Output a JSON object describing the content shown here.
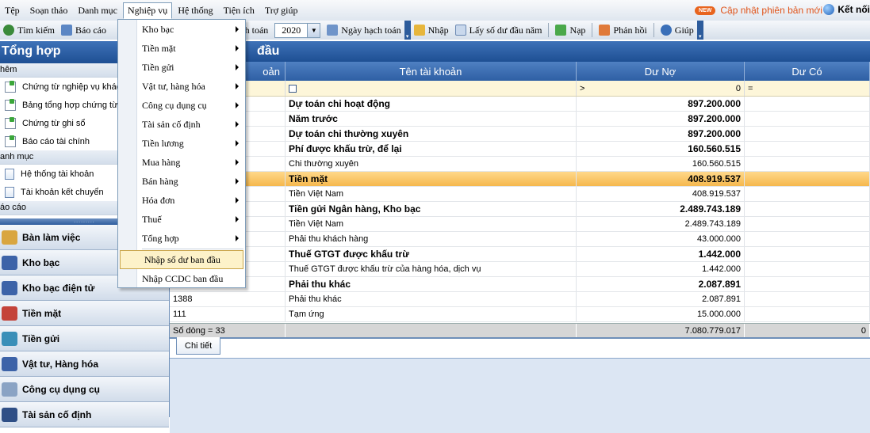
{
  "menubar": {
    "items": [
      "Tệp",
      "Soạn thảo",
      "Danh mục",
      "Nghiệp vụ",
      "Hệ thống",
      "Tiện ích",
      "Trợ giúp"
    ],
    "update_badge": "NEW",
    "update_text": "Cập nhật phiên bản mới",
    "connect_text": "Kết nối"
  },
  "toolbar": {
    "search": "Tìm kiếm",
    "report": "Báo cáo",
    "period": "hạch toán",
    "year": "2020",
    "posting_date": "Ngày hạch toán",
    "import": "Nhập",
    "opening_balance": "Lấy số dư đầu năm",
    "load": "Nạp",
    "feedback": "Phản hồi",
    "help": "Giúp"
  },
  "left_panel": {
    "title": "Tổng hợp",
    "group_add": "hêm",
    "items_add": [
      "Chứng từ nghiệp vụ khác",
      "Bảng tổng hợp chứng từ",
      "Chứng từ ghi sổ",
      "Báo cáo tài chính"
    ],
    "group_catalog": "anh mục",
    "items_catalog": [
      "Hệ thống tài khoản",
      "Tài khoản kết chuyển"
    ],
    "group_report": "áo cáo",
    "nav": [
      "Bàn làm việc",
      "Kho bạc",
      "Kho bạc điện tử",
      "Tiền mặt",
      "Tiền gửi",
      "Vật tư, Hàng hóa",
      "Công cụ dụng cụ",
      "Tài sản cố định"
    ]
  },
  "main": {
    "title": "đầu",
    "columns": [
      "oản",
      "Tên tài khoản",
      "Dư Nợ",
      "Dư Có"
    ],
    "filter_op1": ">",
    "filter_val": "0",
    "filter_op2": "=",
    "rows": [
      {
        "code": "",
        "name": "Dự toán chi hoạt động",
        "debit": "897.200.000",
        "bold": true
      },
      {
        "code": "",
        "name": "Năm trước",
        "debit": "897.200.000",
        "bold": true
      },
      {
        "code": "",
        "name": "Dự toán chi thường xuyên",
        "debit": "897.200.000",
        "bold": true
      },
      {
        "code": "",
        "name": "Phí được khấu trừ, để lại",
        "debit": "160.560.515",
        "bold": true
      },
      {
        "code": "",
        "name": "Chi thường xuyên",
        "debit": "160.560.515",
        "bold": false
      },
      {
        "code": "",
        "name": "Tiền mặt",
        "debit": "408.919.537",
        "bold": true,
        "selected": true
      },
      {
        "code": "",
        "name": "Tiền Việt Nam",
        "debit": "408.919.537",
        "bold": false
      },
      {
        "code": "",
        "name": "Tiền gửi Ngân hàng, Kho bạc",
        "debit": "2.489.743.189",
        "bold": true
      },
      {
        "code": "",
        "name": "Tiền Việt Nam",
        "debit": "2.489.743.189",
        "bold": false
      },
      {
        "code": "",
        "name": "Phải thu khách hàng",
        "debit": "43.000.000",
        "bold": false
      },
      {
        "code": "",
        "name": "Thuế GTGT được khấu trừ",
        "debit": "1.442.000",
        "bold": true
      },
      {
        "code": "",
        "name": "Thuế GTGT được khấu trừ của hàng hóa, dịch vụ",
        "debit": "1.442.000",
        "bold": false
      },
      {
        "code": "",
        "name": "Phải thu khác",
        "debit": "2.087.891",
        "bold": true
      },
      {
        "code": "1388",
        "name": "Phải thu khác",
        "debit": "2.087.891",
        "bold": false
      },
      {
        "code": "111",
        "name": "Tạm ứng",
        "debit": "15.000.000",
        "bold": false
      }
    ],
    "footer_count": "Số dòng = 33",
    "footer_debit": "7.080.779.017",
    "footer_credit": "0",
    "tab_detail": "Chi tiết"
  },
  "dropdown": {
    "items": [
      "Kho bạc",
      "Tiền mặt",
      "Tiền gửi",
      "Vật tư, hàng hóa",
      "Công cụ dụng cụ",
      "Tài sản cố định",
      "Tiền lương",
      "Mua hàng",
      "Bán hàng",
      "Hóa đơn",
      "Thuế",
      "Tổng hợp"
    ],
    "highlight": "Nhập số dư ban đầu",
    "last": "Nhập CCDC ban đầu"
  },
  "colors": {
    "accent": "#1e4f93",
    "selected_row": "#f5b84d",
    "update": "#e0541a"
  }
}
